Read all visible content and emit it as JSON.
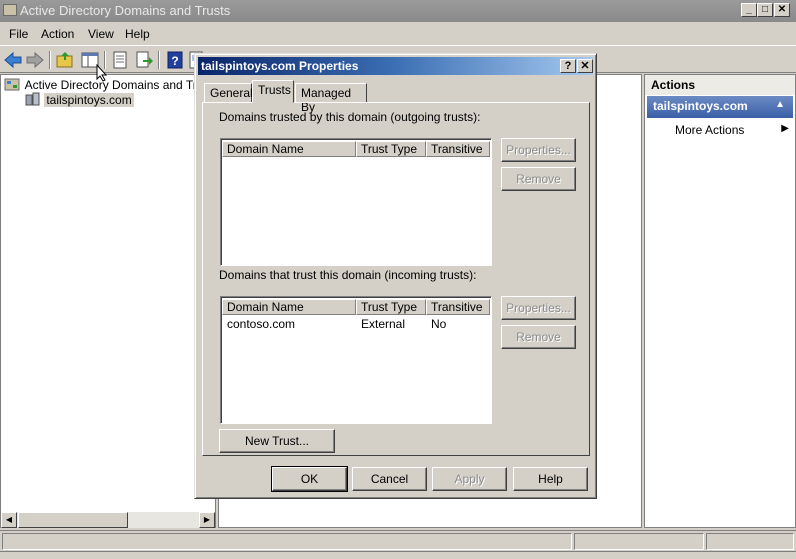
{
  "window": {
    "title": "Active Directory Domains and Trusts",
    "controls": [
      "_",
      "□",
      "✕"
    ]
  },
  "menu": [
    "File",
    "Action",
    "View",
    "Help"
  ],
  "toolbar": {
    "icons": [
      "back-arrow-icon",
      "forward-arrow-icon",
      "up-folder-icon",
      "show-hide-tree-icon",
      "properties-icon",
      "export-list-icon",
      "help-icon",
      "help-topics-icon"
    ]
  },
  "tree": {
    "root": "Active Directory Domains and Trusts",
    "child": "tailspintoys.com"
  },
  "actions": {
    "header": "Actions",
    "selected": "tailspintoys.com",
    "more": "More Actions"
  },
  "dialog": {
    "title": "tailspintoys.com Properties",
    "title_buttons": [
      "?",
      "✕"
    ],
    "tabs": [
      "General",
      "Trusts",
      "Managed By"
    ],
    "active_tab": "Trusts",
    "outgoing_label": "Domains trusted by this domain (outgoing trusts):",
    "incoming_label": "Domains that trust this domain (incoming trusts):",
    "columns": [
      "Domain Name",
      "Trust Type",
      "Transitive"
    ],
    "outgoing_rows": [],
    "incoming_rows": [
      {
        "domain": "contoso.com",
        "type": "External",
        "transitive": "No"
      }
    ],
    "properties_label": "Properties...",
    "remove_label": "Remove",
    "new_trust_label": "New Trust...",
    "ok_label": "OK",
    "cancel_label": "Cancel",
    "apply_label": "Apply",
    "help_label": "Help"
  }
}
